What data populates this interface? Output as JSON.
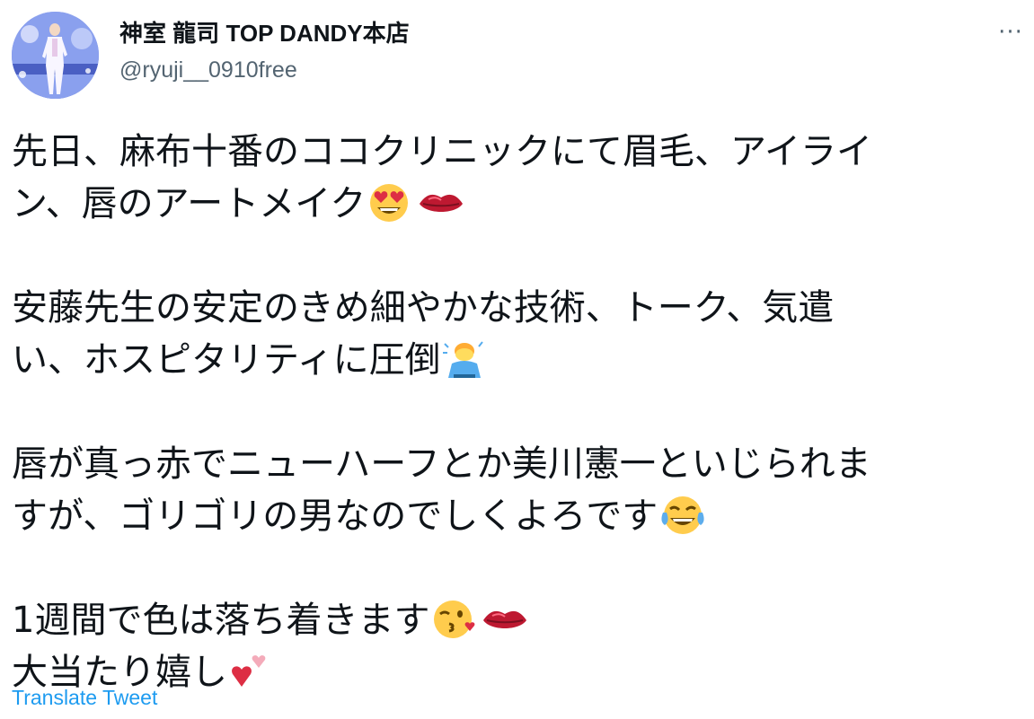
{
  "author": {
    "display_name": "神室 龍司 TOP DANDY本店",
    "handle": "@ryuji__0910free"
  },
  "more_icon": "more-dots-icon",
  "tweet": {
    "line_1": "先日、麻布十番のココクリニックにて眉毛、アイライ",
    "line_2": "ン、唇のアートメイク",
    "line_3": "安藤先生の安定のきめ細やかな技術、トーク、気遣",
    "line_4": "い、ホスピタリティに圧倒",
    "line_5": "唇が真っ赤でニューハーフとか美川憲一といじられま",
    "line_6": "すが、ゴリゴリの男なのでしくよろです",
    "line_7": "1週間で色は落ち着きます",
    "line_8": "大当たり嬉し"
  },
  "emojis": [
    "heart-eyes-emoji",
    "lips-emoji",
    "bowing-man-emoji",
    "tears-of-joy-emoji",
    "kissing-heart-emoji",
    "two-hearts-emoji"
  ],
  "translate_label": "Translate Tweet",
  "colors": {
    "text": "#0f1419",
    "secondary": "#536471",
    "link": "#1d9bf0"
  }
}
